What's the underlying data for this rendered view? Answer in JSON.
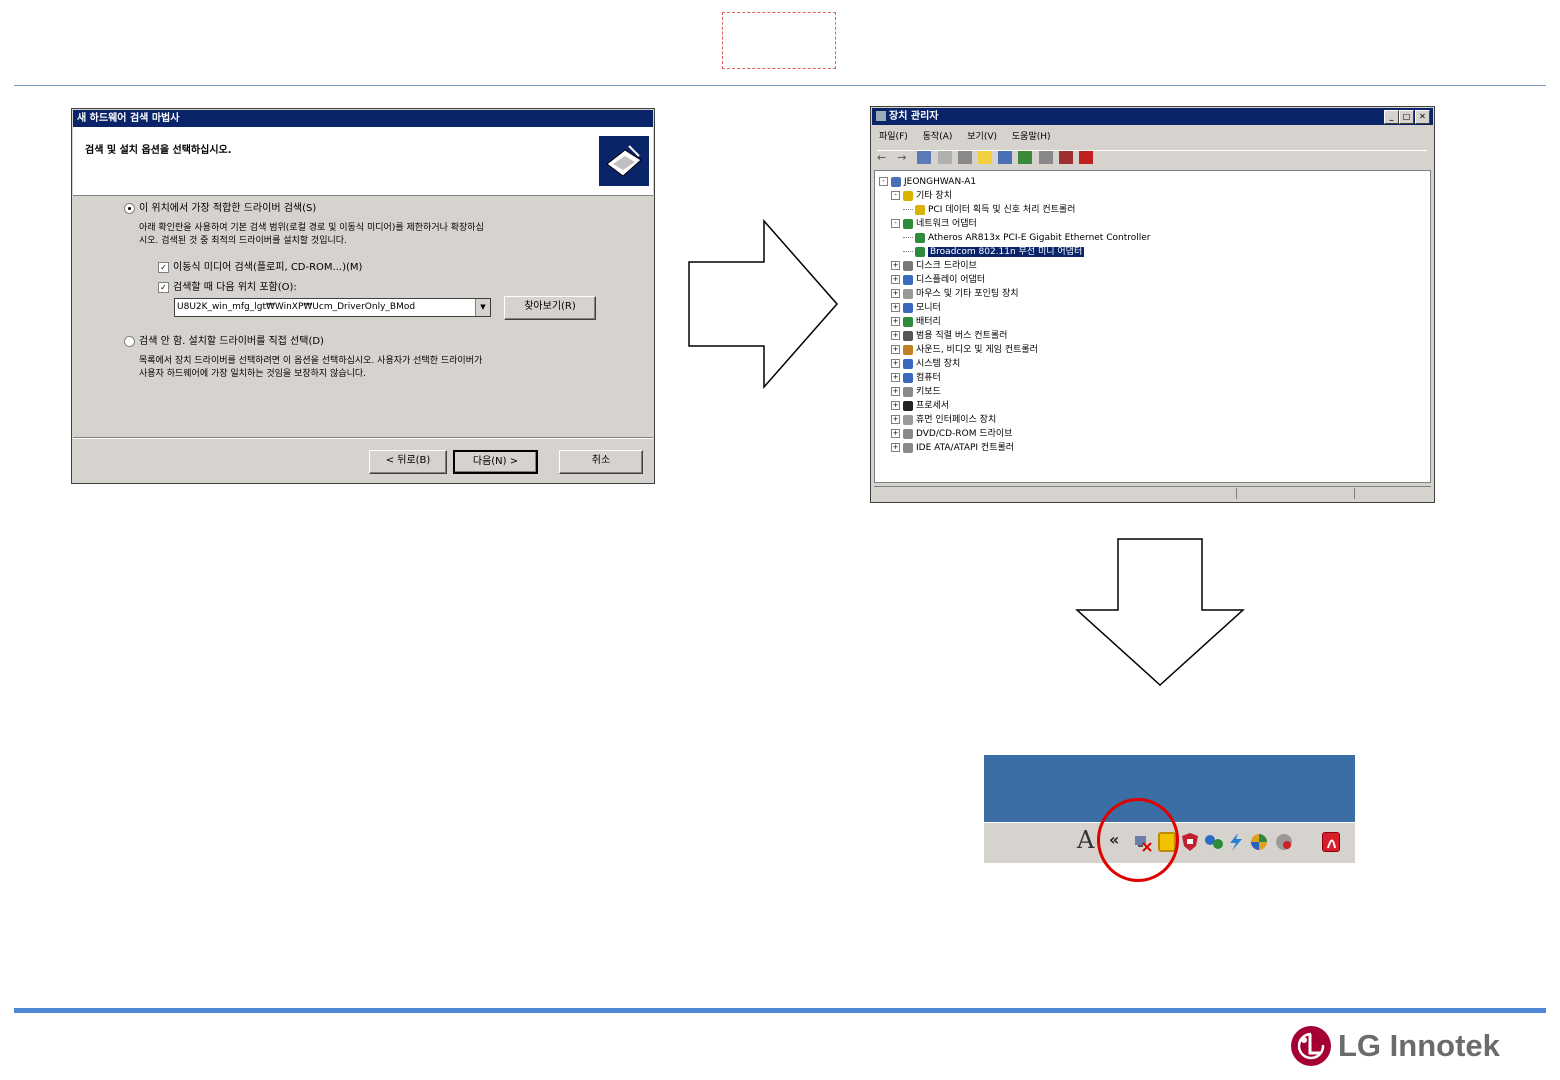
{
  "wizard": {
    "title": "새 하드웨어 검색 마법사",
    "heading": "검색 및 설치 옵션을 선택하십시오.",
    "option1_label": "이 위치에서 가장 적합한 드라이버 검색(S)",
    "option1_desc_line1": "아래 확인란을 사용하여 기본 검색 범위(로컬 경로 및 이동식 미디어)를 제한하거나 확장하십",
    "option1_desc_line2": "시오. 검색된 것 중 최적의 드라이버를 설치할 것입니다.",
    "check1_label": "이동식 미디어 검색(플로피, CD-ROM...)(M)",
    "check2_label": "검색할 때 다음 위치 포함(O):",
    "path_value": "U8U2K_win_mfg_lgt₩WinXP₩Ucm_DriverOnly_BMod",
    "browse_button": "찾아보기(R)",
    "option2_label": "검색 안 함. 설치할 드라이버를 직접 선택(D)",
    "option2_desc_line1": "목록에서 장치 드라이버를 선택하려면 이 옵션을 선택하십시오. 사용자가 선택한 드라이버가",
    "option2_desc_line2": "사용자 하드웨어에 가장 일치하는 것임을 보장하지 않습니다.",
    "back_button": "< 뒤로(B)",
    "next_button": "다음(N) >",
    "cancel_button": "취소"
  },
  "devmgr": {
    "title": "장치 관리자",
    "menu": [
      "파일(F)",
      "동작(A)",
      "보기(V)",
      "도움말(H)"
    ],
    "tree": [
      {
        "label": "JEONGHWAN-A1",
        "level": 0,
        "expander": "-",
        "color": "#4a6fb5"
      },
      {
        "label": "기타 장치",
        "level": 1,
        "expander": "-",
        "color": "#d8b400"
      },
      {
        "label": "PCI 데이터 획득 및 신호 처리 컨트롤러",
        "level": 2,
        "expander": "",
        "color": "#d8b400"
      },
      {
        "label": "네트워크 어댑터",
        "level": 1,
        "expander": "-",
        "color": "#2e8b3a"
      },
      {
        "label": "Atheros AR813x PCI-E Gigabit Ethernet Controller",
        "level": 2,
        "expander": "",
        "color": "#2e8b3a"
      },
      {
        "label": "Broadcom 802.11n 무선 미니 어댑터",
        "level": 2,
        "expander": "",
        "color": "#2e8b3a",
        "selected": true
      },
      {
        "label": "디스크 드라이브",
        "level": 1,
        "expander": "+",
        "color": "#7a7a7a"
      },
      {
        "label": "디스플레이 어댑터",
        "level": 1,
        "expander": "+",
        "color": "#3a6ac0"
      },
      {
        "label": "마우스 및 기타 포인팅 장치",
        "level": 1,
        "expander": "+",
        "color": "#9a9a9a"
      },
      {
        "label": "모니터",
        "level": 1,
        "expander": "+",
        "color": "#3a6ac0"
      },
      {
        "label": "배터리",
        "level": 1,
        "expander": "+",
        "color": "#2e8b3a"
      },
      {
        "label": "범용 직렬 버스 컨트롤러",
        "level": 1,
        "expander": "+",
        "color": "#555555"
      },
      {
        "label": "사운드, 비디오 및 게임 컨트롤러",
        "level": 1,
        "expander": "+",
        "color": "#c08020"
      },
      {
        "label": "시스템 장치",
        "level": 1,
        "expander": "+",
        "color": "#3a6ac0"
      },
      {
        "label": "컴퓨터",
        "level": 1,
        "expander": "+",
        "color": "#3a6ac0"
      },
      {
        "label": "키보드",
        "level": 1,
        "expander": "+",
        "color": "#8a8a8a"
      },
      {
        "label": "프로세서",
        "level": 1,
        "expander": "+",
        "color": "#222222"
      },
      {
        "label": "휴먼 인터페이스 장치",
        "level": 1,
        "expander": "+",
        "color": "#9a9a9a"
      },
      {
        "label": "DVD/CD-ROM 드라이브",
        "level": 1,
        "expander": "+",
        "color": "#8a8a8a"
      },
      {
        "label": "IDE ATA/ATAPI 컨트롤러",
        "level": 1,
        "expander": "+",
        "color": "#8a8a8a"
      }
    ]
  },
  "taskbar": {
    "font_glyph": "A",
    "chevron": "«",
    "icons": [
      "network-disconnected-icon",
      "norton-icon",
      "shield-icon",
      "bluetooth-icon",
      "lightning-icon",
      "swirl-icon",
      "globe-icon",
      "acrobat-icon"
    ],
    "highlight_color": "#e00000",
    "taskbar_color": "#3a6ea5"
  },
  "footer": {
    "logo_text": "LG Innotek",
    "logo_color": "#a50034"
  }
}
